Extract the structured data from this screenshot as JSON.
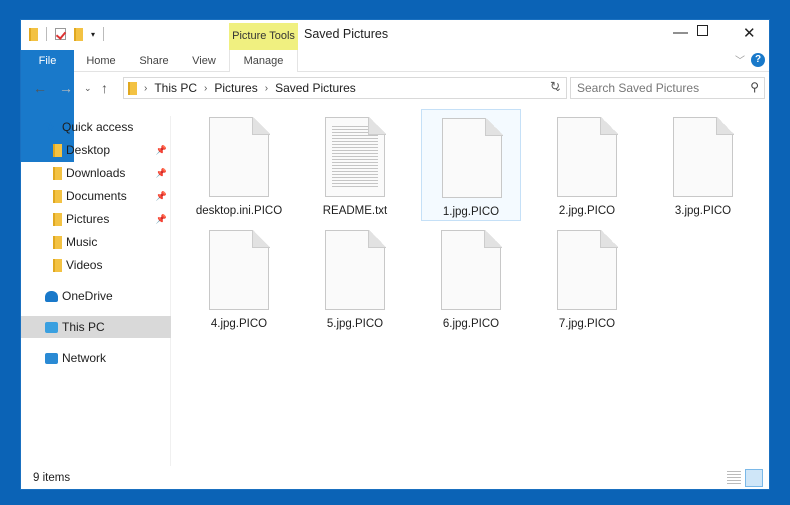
{
  "window": {
    "title": "Saved Pictures",
    "context_tab": "Picture Tools"
  },
  "ribbon": {
    "tabs": [
      "File",
      "Home",
      "Share",
      "View",
      "Manage"
    ]
  },
  "address": {
    "crumbs": [
      "This PC",
      "Pictures",
      "Saved Pictures"
    ],
    "search_placeholder": "Search Saved Pictures"
  },
  "nav": {
    "items": [
      {
        "label": "Quick access",
        "icon": "star-icon"
      },
      {
        "label": "Desktop",
        "icon": "desktop-folder-icon",
        "pinned": true
      },
      {
        "label": "Downloads",
        "icon": "downloads-folder-icon",
        "pinned": true
      },
      {
        "label": "Documents",
        "icon": "documents-folder-icon",
        "pinned": true
      },
      {
        "label": "Pictures",
        "icon": "pictures-folder-icon",
        "pinned": true
      },
      {
        "label": "Music",
        "icon": "music-folder-icon"
      },
      {
        "label": "Videos",
        "icon": "videos-folder-icon"
      },
      {
        "label": "OneDrive",
        "icon": "cloud-icon"
      },
      {
        "label": "This PC",
        "icon": "computer-icon",
        "selected": true
      },
      {
        "label": "Network",
        "icon": "network-icon"
      }
    ]
  },
  "files": [
    {
      "name": "desktop.ini.PICO"
    },
    {
      "name": "README.txt",
      "type": "text"
    },
    {
      "name": "1.jpg.PICO",
      "selected": true
    },
    {
      "name": "2.jpg.PICO"
    },
    {
      "name": "3.jpg.PICO"
    },
    {
      "name": "4.jpg.PICO"
    },
    {
      "name": "5.jpg.PICO"
    },
    {
      "name": "6.jpg.PICO"
    },
    {
      "name": "7.jpg.PICO"
    }
  ],
  "status": {
    "count": "9 items"
  },
  "colors": {
    "accent": "#1979ca",
    "desktop": "#0b63b6",
    "context_tab": "#f0f080"
  }
}
